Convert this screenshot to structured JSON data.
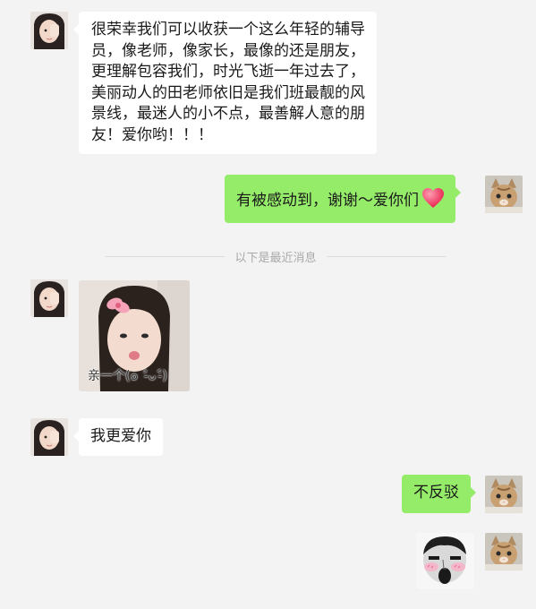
{
  "messages": [
    {
      "side": "left",
      "type": "text",
      "text": "很荣幸我们可以收获一个这么年轻的辅导员，像老师，像家长，最像的还是朋友，更理解包容我们，时光飞逝一年过去了，美丽动人的田老师依旧是我们班最靓的风景线，最迷人的小不点，最善解人意的朋友！爱你哟！！！"
    },
    {
      "side": "right",
      "type": "text",
      "text": "有被感动到，谢谢～爱你们",
      "emoji": "heart-icon"
    },
    {
      "side": "left",
      "type": "image",
      "caption": "亲一个(๑ ˃̵ᴗ˂̵)"
    },
    {
      "side": "left",
      "type": "text",
      "text": "我更爱你"
    },
    {
      "side": "right",
      "type": "text",
      "text": "不反驳"
    },
    {
      "side": "right",
      "type": "sticker",
      "icon": "meme-sticker-icon"
    }
  ],
  "divider": {
    "text": "以下是最近消息"
  },
  "colors": {
    "background": "#f3f3f3",
    "bubble_left": "#ffffff",
    "bubble_right": "#95ec69"
  }
}
